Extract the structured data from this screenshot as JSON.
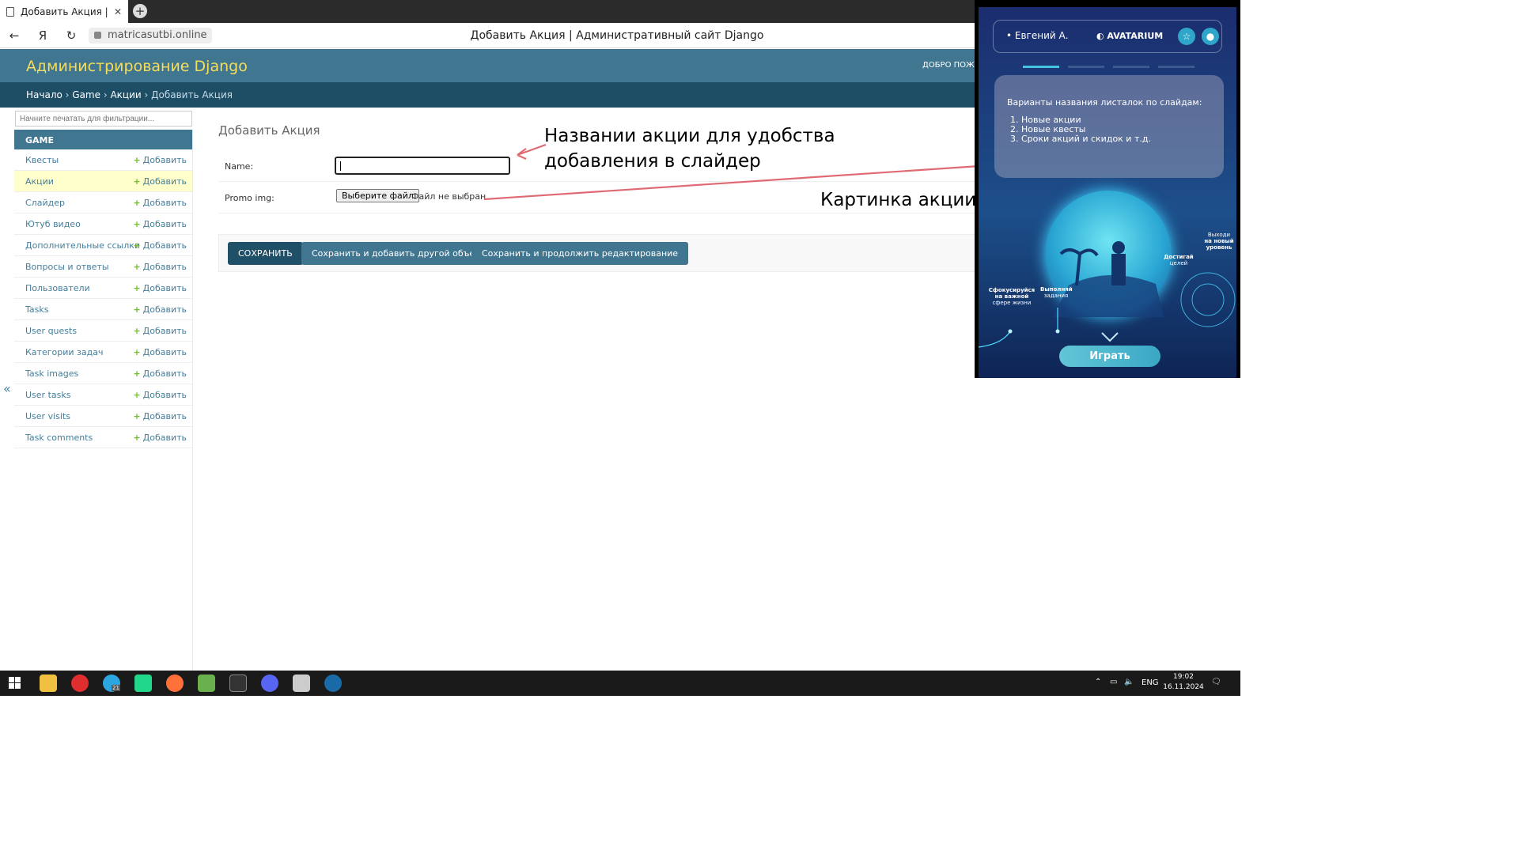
{
  "browser": {
    "tab_title": "Добавить Акция | Адм",
    "url": "matricasutbi.online",
    "page_title": "Добавить Акция | Административный сайт Django"
  },
  "header": {
    "brand": "Администрирование Django",
    "welcome": "ДОБРО ПОЖАЛ"
  },
  "breadcrumbs": [
    "Начало",
    "Game",
    "Акции",
    "Добавить Акция"
  ],
  "sidebar": {
    "filter_placeholder": "Начните печатать для фильтрации...",
    "app": "GAME",
    "add_label": "Добавить",
    "items": [
      {
        "label": "Квесты"
      },
      {
        "label": "Акции"
      },
      {
        "label": "Слайдер"
      },
      {
        "label": "Ютуб видео"
      },
      {
        "label": "Дополнительные ссылки"
      },
      {
        "label": "Вопросы и ответы"
      },
      {
        "label": "Пользователи"
      },
      {
        "label": "Tasks"
      },
      {
        "label": "User quests"
      },
      {
        "label": "Категории задач"
      },
      {
        "label": "Task images"
      },
      {
        "label": "User tasks"
      },
      {
        "label": "User visits"
      },
      {
        "label": "Task comments"
      }
    ],
    "collapse": "«"
  },
  "form": {
    "title": "Добавить Акция",
    "name_label": "Name:",
    "promo_label": "Promo img:",
    "file_button": "Выберите файл",
    "file_none": "Файл не выбран",
    "save": "СОХРАНИТЬ",
    "save_add": "Сохранить и добавить другой объект",
    "save_continue": "Сохранить и продолжить редактирование"
  },
  "annotations": {
    "name_note_line1": "Названии акции для удобства",
    "name_note_line2": "добавления в слайдер",
    "image_note": "Картинка акции",
    "color": "#e06a73"
  },
  "preview": {
    "user": "• Евгений А.",
    "brand": "◐ AVATARIUM",
    "card_heading": "Варианты названия листалок по слайдам:",
    "card_items": [
      "Новые акции",
      "Новые квесты",
      "Сроки акций и скидок и т.д."
    ],
    "label_focus_1": "Сфокусируйся",
    "label_focus_2": "на важной",
    "label_focus_3": "сфере жизни",
    "label_do_1": "Выполняй",
    "label_do_2": "задания",
    "label_reach_1": "Достигай",
    "label_reach_2": "целей",
    "label_level_1": "Выходи",
    "label_level_2": "на новый",
    "label_level_3": "уровень",
    "play": "Играть"
  },
  "taskbar": {
    "lang": "ENG",
    "time": "19:02",
    "date": "16.11.2024",
    "telegram_badge": "21"
  }
}
